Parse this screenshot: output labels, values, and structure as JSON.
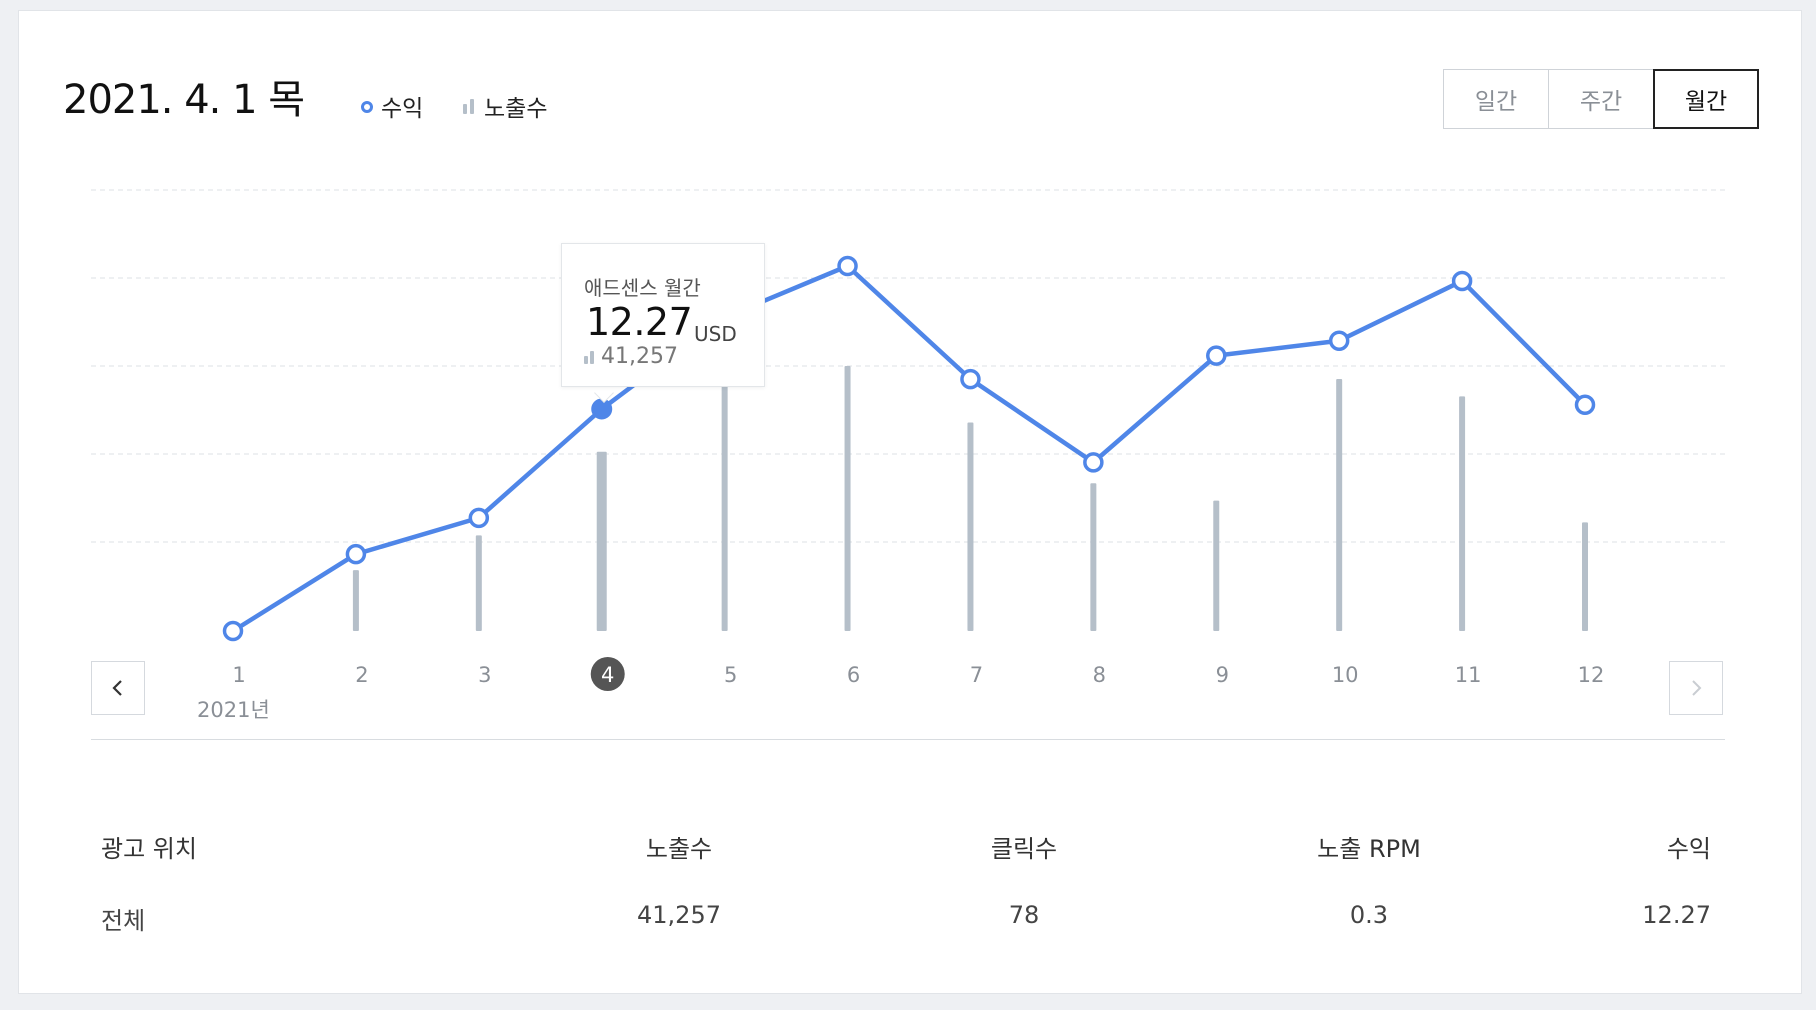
{
  "header": {
    "title": "2021. 4. 1 목",
    "legend_revenue": "수익",
    "legend_impressions": "노출수"
  },
  "period_tabs": [
    "일간",
    "주간",
    "월간"
  ],
  "period_selected": "월간",
  "year_label": "2021년",
  "tooltip": {
    "title": "애드센스 월간",
    "value": "12.27",
    "unit": "USD",
    "impressions": "41,257"
  },
  "colors": {
    "line": "#4f86e8",
    "bar": "#b5bfc9",
    "grid": "#e3e6e9",
    "selected_month": "#555555"
  },
  "chart_data": {
    "type": "line",
    "categories": [
      "1",
      "2",
      "3",
      "4",
      "5",
      "6",
      "7",
      "8",
      "9",
      "10",
      "11",
      "12"
    ],
    "selected_index": 3,
    "series": [
      {
        "name": "수익",
        "type": "line",
        "values": [
          0.0,
          3.6,
          5.3,
          10.4,
          14.7,
          17.1,
          11.8,
          7.9,
          12.9,
          13.6,
          16.4,
          10.6
        ]
      },
      {
        "name": "노출수",
        "type": "bar",
        "values": [
          0,
          14000,
          22000,
          41257,
          57000,
          61000,
          48000,
          34000,
          30000,
          58000,
          54000,
          25000
        ]
      }
    ]
  },
  "table": {
    "headers": [
      "광고 위치",
      "노출수",
      "클릭수",
      "노출 RPM",
      "수익"
    ],
    "rows": [
      [
        "전체",
        "41,257",
        "78",
        "0.3",
        "12.27"
      ]
    ]
  }
}
